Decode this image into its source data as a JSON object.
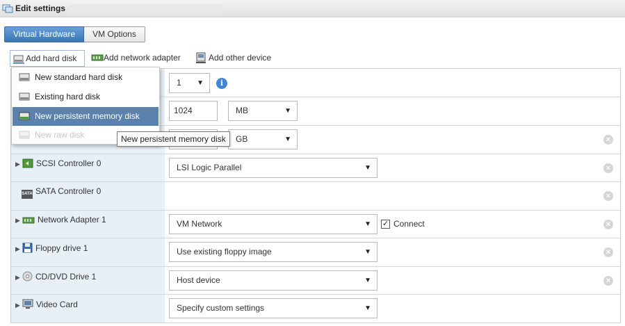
{
  "window": {
    "title": "Edit settings -"
  },
  "tabs": [
    {
      "label": "Virtual Hardware",
      "active": true
    },
    {
      "label": "VM Options",
      "active": false
    }
  ],
  "toolbar": {
    "add_hard_disk": "Add hard disk",
    "add_network_adapter": "Add network adapter",
    "add_other_device": "Add other device"
  },
  "menu": {
    "items": [
      {
        "label": "New standard hard disk",
        "icon": "hard-disk-icon",
        "state": "normal"
      },
      {
        "label": "Existing hard disk",
        "icon": "hard-disk-icon",
        "state": "normal"
      },
      {
        "label": "New persistent memory disk",
        "icon": "persistent-memory-disk-icon",
        "state": "highlighted"
      },
      {
        "label": "New raw disk",
        "icon": "raw-disk-icon",
        "state": "disabled"
      }
    ]
  },
  "tooltip": {
    "text": "New persistent memory disk"
  },
  "rows": {
    "cpu": {
      "value": "1"
    },
    "memory": {
      "value": "1024",
      "unit": "MB"
    },
    "hard_disk": {
      "unit": "GB"
    },
    "scsi": {
      "label": "SCSI Controller 0",
      "value": "LSI Logic Parallel"
    },
    "sata": {
      "label": "SATA Controller 0",
      "icon_text": "SATA"
    },
    "network": {
      "label": "Network Adapter 1",
      "value": "VM Network",
      "connect_label": "Connect",
      "connected": true
    },
    "floppy": {
      "label": "Floppy drive 1",
      "value": "Use existing floppy image"
    },
    "cddvd": {
      "label": "CD/DVD Drive 1",
      "value": "Host device"
    },
    "video": {
      "label": "Video Card",
      "value": "Specify custom settings"
    }
  },
  "symbols": {
    "caret": "▼",
    "expand_arrow": "▶",
    "remove": "×",
    "info": "i",
    "check": "✓"
  },
  "colors": {
    "tab_active": "#3a76b8",
    "menu_highlight": "#5b81ad",
    "left_column": "#e8f0f7",
    "info_blue": "#3f86d6"
  }
}
